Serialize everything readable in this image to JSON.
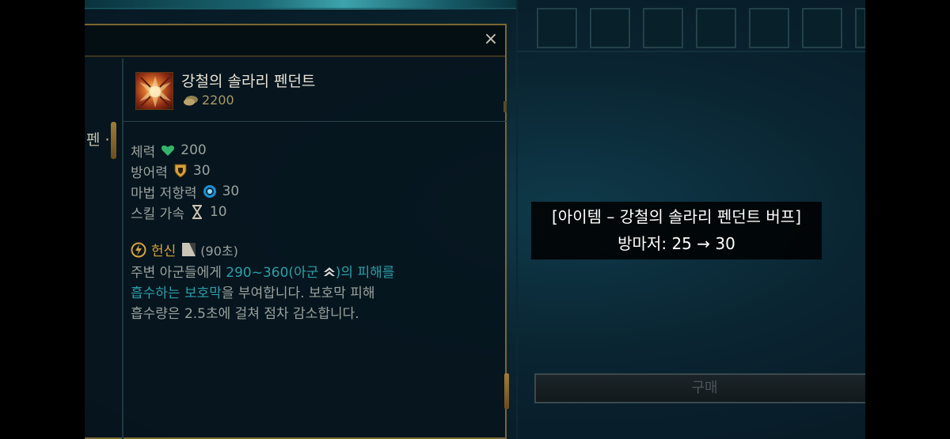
{
  "item": {
    "name": "강철의 솔라리 펜던트",
    "price": "2200",
    "icon": "solari-pendant-icon"
  },
  "stats": [
    {
      "label": "체력",
      "icon": "heart-icon",
      "value": "200"
    },
    {
      "label": "방어력",
      "icon": "shield-icon",
      "value": "30"
    },
    {
      "label": "마법 저항력",
      "icon": "magic-resist-icon",
      "value": "30"
    },
    {
      "label": "스킬 가속",
      "icon": "hourglass-icon",
      "value": "10"
    }
  ],
  "passive": {
    "name": "헌신",
    "cooldown": "(90초)",
    "desc_1": "주변 아군들에게 ",
    "desc_hl_1": "290~360(아군 ",
    "desc_hl_2": ")의 피해를",
    "desc_hl_3": "흡수하는 보호막",
    "desc_2": "을 부여합니다. 보호막 피해",
    "desc_3": "흡수량은 2.5초에 걸쳐 점차 감소합니다."
  },
  "list": {
    "partial_label": "펜 ·"
  },
  "close_label": "×",
  "buy_label": "구매",
  "caption": {
    "line1": "[아이템 – 강철의 솔라리 펜던트 버프]",
    "line2": "방마저: 25 → 30"
  },
  "colors": {
    "accent_gold": "#d6a33a",
    "highlight_teal": "#2c9fa8",
    "heart_green": "#34b46a"
  }
}
